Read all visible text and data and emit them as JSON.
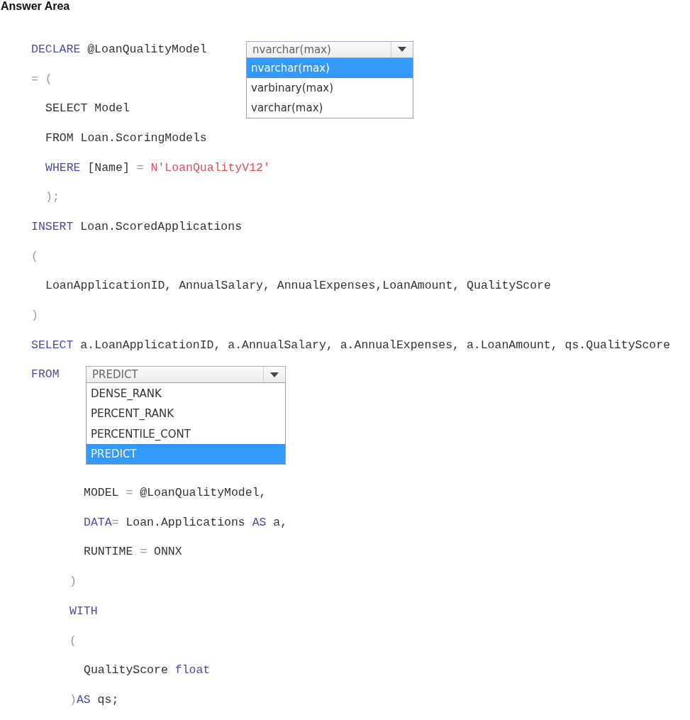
{
  "heading": "Answer Area",
  "code": [
    {
      "kind": "line",
      "tokens": [
        {
          "text": "DECLARE",
          "kind": "keyword"
        },
        {
          "text": " @LoanQualityModel",
          "kind": "plain"
        }
      ],
      "dropdown": {
        "value": "nvarchar(max)",
        "options": [
          {
            "label": "nvarchar(max)",
            "selected": true
          },
          {
            "label": "varbinary(max)",
            "selected": false
          },
          {
            "label": "varchar(max)",
            "selected": false
          }
        ]
      }
    },
    {
      "kind": "line",
      "tokens": [
        {
          "text": "= (",
          "kind": "operator"
        }
      ],
      "children": [
        {
          "kind": "line",
          "tokens": [
            {
              "text": "SELECT",
              "kind": "plain"
            },
            {
              "text": " Model",
              "kind": "plain"
            }
          ]
        },
        {
          "kind": "line",
          "tokens": [
            {
              "text": "FROM",
              "kind": "plain"
            },
            {
              "text": " Loan.ScoringModels",
              "kind": "plain"
            }
          ]
        },
        {
          "kind": "line",
          "tokens": [
            {
              "text": "WHERE",
              "kind": "keyword"
            },
            {
              "text": " [Name] ",
              "kind": "plain"
            },
            {
              "text": "=",
              "kind": "operator"
            },
            {
              "text": " N'LoanQualityV12'",
              "kind": "string"
            }
          ]
        },
        {
          "kind": "line",
          "tokens": [
            {
              "text": ");",
              "kind": "operator"
            }
          ]
        }
      ]
    },
    {
      "kind": "line",
      "tokens": [
        {
          "text": "INSERT",
          "kind": "keyword"
        },
        {
          "text": " Loan.ScoredApplications",
          "kind": "plain"
        }
      ]
    },
    {
      "kind": "line",
      "tokens": [
        {
          "text": "(",
          "kind": "operator"
        }
      ]
    },
    {
      "kind": "block",
      "children": [
        {
          "kind": "line",
          "tokens": [
            {
              "text": "LoanApplicationID, AnnualSalary, AnnualExpenses,LoanAmount, QualityScore",
              "kind": "plain"
            }
          ]
        }
      ]
    },
    {
      "kind": "line",
      "tokens": [
        {
          "text": ")",
          "kind": "operator"
        }
      ]
    },
    {
      "kind": "line",
      "tokens": [
        {
          "text": "SELECT",
          "kind": "keyword"
        },
        {
          "text": " a.LoanApplicationID, a.AnnualSalary, a.AnnualExpenses, a.LoanAmount, qs.QualityScore",
          "kind": "plain"
        }
      ]
    },
    {
      "kind": "line",
      "tokens": [
        {
          "text": "FROM",
          "kind": "keyword"
        }
      ],
      "dropdown": {
        "value": "PREDICT",
        "options": [
          {
            "label": "DENSE_RANK",
            "selected": false
          },
          {
            "label": "PERCENT_RANK",
            "selected": false
          },
          {
            "label": "PERCENTILE_CONT",
            "selected": false
          },
          {
            "label": "PREDICT",
            "selected": true
          }
        ]
      },
      "children": [
        {
          "kind": "block",
          "children": [
            {
              "kind": "line",
              "tokens": [
                {
                  "text": "MODEL ",
                  "kind": "plain"
                },
                {
                  "text": "=",
                  "kind": "operator"
                },
                {
                  "text": " @LoanQualityModel,",
                  "kind": "plain"
                }
              ]
            },
            {
              "kind": "line",
              "tokens": [
                {
                  "text": "DATA",
                  "kind": "keyword"
                },
                {
                  "text": "=",
                  "kind": "operator"
                },
                {
                  "text": " Loan.Applications ",
                  "kind": "plain"
                },
                {
                  "text": "AS",
                  "kind": "keyword"
                },
                {
                  "text": " a,",
                  "kind": "plain"
                }
              ]
            },
            {
              "kind": "line",
              "tokens": [
                {
                  "text": "RUNTIME ",
                  "kind": "plain"
                },
                {
                  "text": "=",
                  "kind": "operator"
                },
                {
                  "text": " ONNX",
                  "kind": "plain"
                }
              ]
            }
          ]
        },
        {
          "kind": "line",
          "tokens": [
            {
              "text": ")",
              "kind": "operator"
            }
          ]
        },
        {
          "kind": "line",
          "tokens": [
            {
              "text": "WITH",
              "kind": "keyword"
            }
          ]
        },
        {
          "kind": "line",
          "tokens": [
            {
              "text": "(",
              "kind": "operator"
            }
          ]
        },
        {
          "kind": "block",
          "children": [
            {
              "kind": "line",
              "tokens": [
                {
                  "text": "QualityScore ",
                  "kind": "plain"
                },
                {
                  "text": "float",
                  "kind": "keyword"
                }
              ]
            }
          ]
        },
        {
          "kind": "line",
          "tokens": [
            {
              "text": ")",
              "kind": "operator"
            },
            {
              "text": "AS",
              "kind": "keyword"
            },
            {
              "text": " qs;",
              "kind": "plain"
            }
          ]
        }
      ]
    }
  ]
}
